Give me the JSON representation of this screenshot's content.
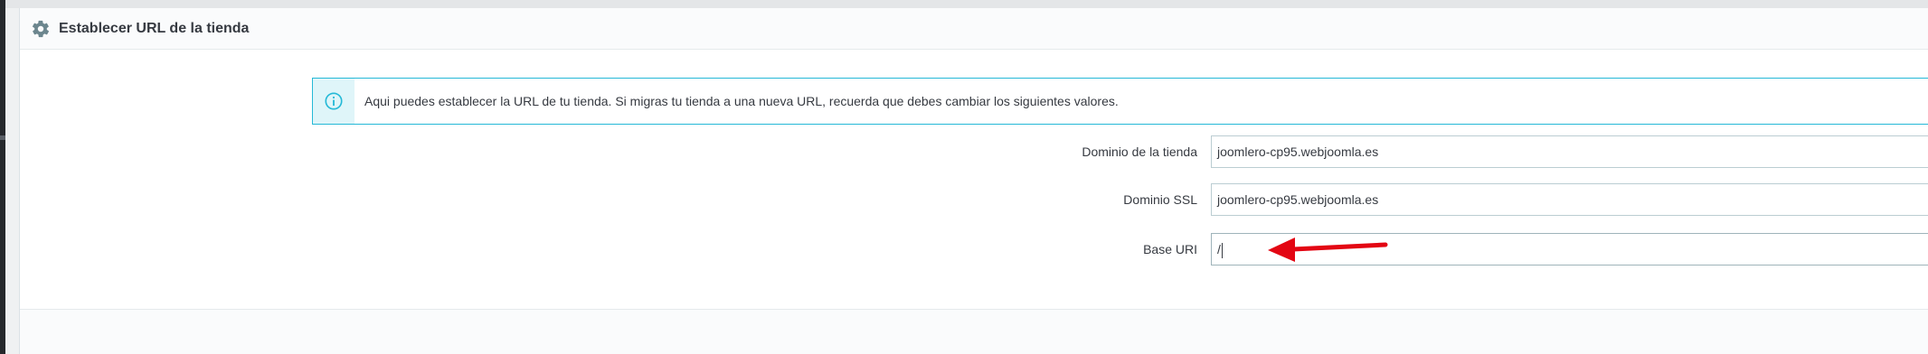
{
  "panel": {
    "title": "Establecer URL de la tienda",
    "icon": "gear-icon"
  },
  "alert": {
    "icon": "info-icon",
    "text": "Aqui puedes establecer la URL de tu tienda. Si migras tu tienda a una nueva URL, recuerda que debes cambiar los siguientes valores."
  },
  "fields": [
    {
      "label": "Dominio de la tienda",
      "value": "joomlero-cp95.webjoomla.es"
    },
    {
      "label": "Dominio SSL",
      "value": "joomlero-cp95.webjoomla.es"
    },
    {
      "label": "Base URI",
      "value": "/"
    }
  ],
  "colors": {
    "accent": "#25b9d7",
    "alert_bg": "#dff5f9",
    "annotation_arrow": "#e30613",
    "input_border": "#bbcdd2"
  }
}
